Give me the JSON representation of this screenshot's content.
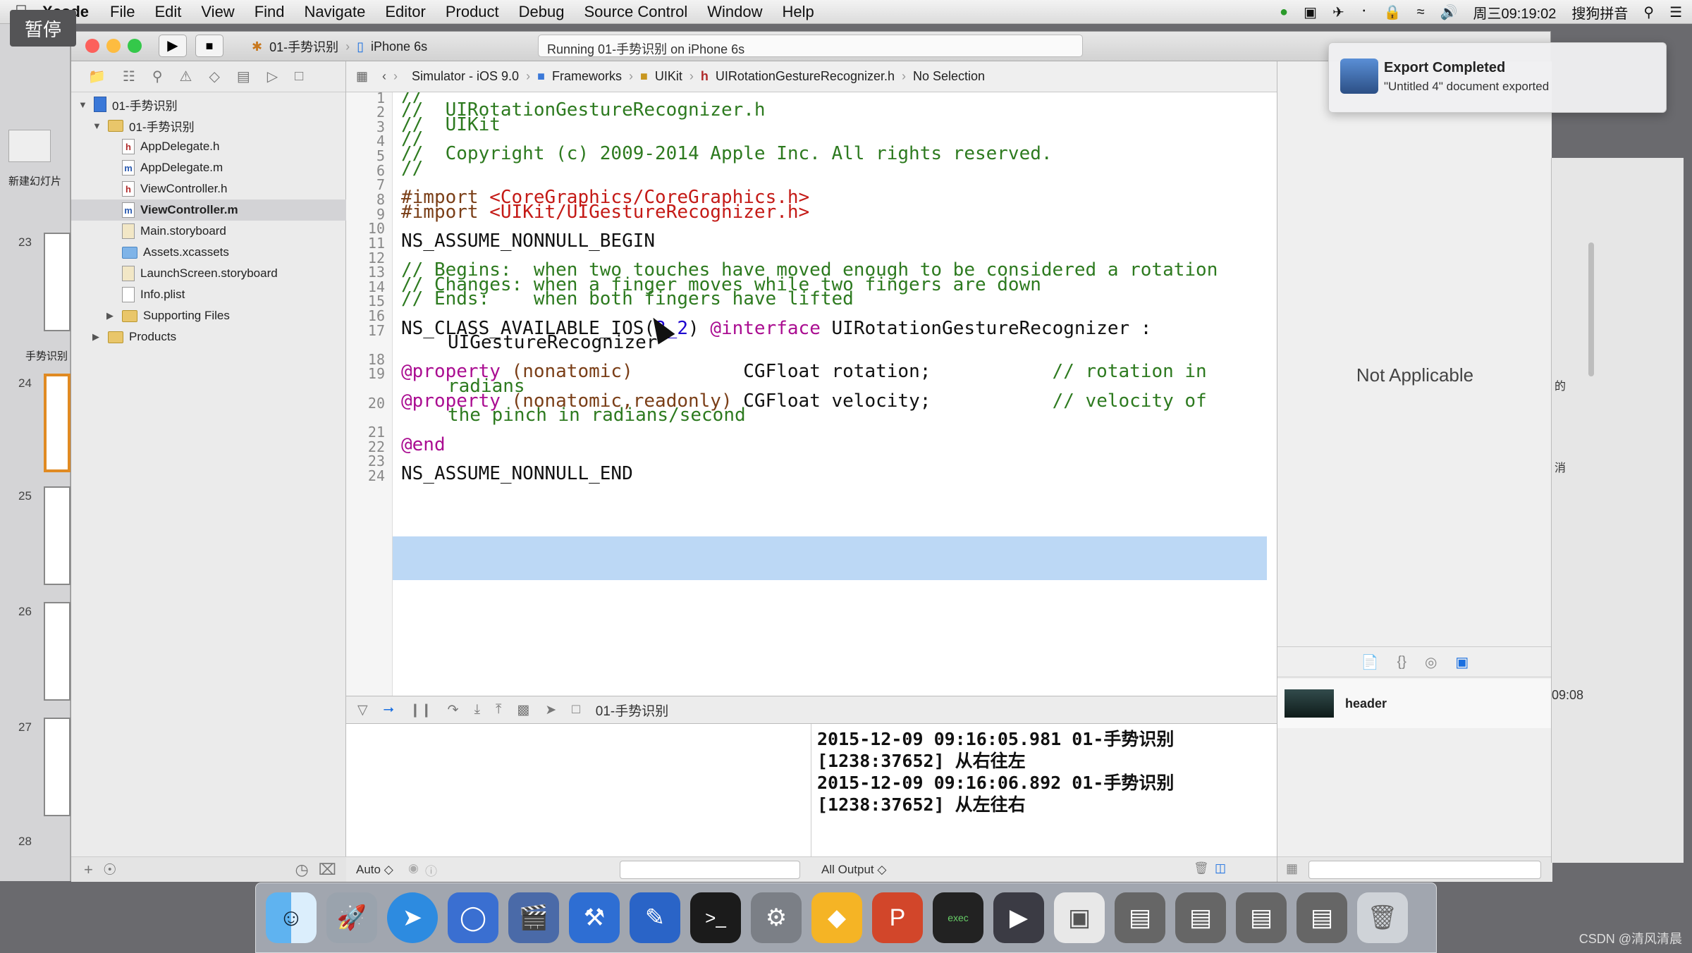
{
  "menubar": {
    "app_name": "Xcode",
    "items": [
      "File",
      "Edit",
      "View",
      "Find",
      "Navigate",
      "Editor",
      "Product",
      "Debug",
      "Source Control",
      "Window",
      "Help"
    ],
    "clock": "周三09:19:02",
    "input_method": "搜狗拼音"
  },
  "keynote": {
    "pause_label": "暂停",
    "new_slide_label": "新建幻灯片",
    "group_label": "手势识别",
    "slide_numbers": [
      "23",
      "24",
      "25",
      "26",
      "27",
      "28"
    ]
  },
  "toolbar": {
    "scheme": "01-手势识别",
    "device": "iPhone 6s",
    "activity": "Running 01-手势识别 on iPhone 6s"
  },
  "navigator": {
    "project": "01-手势识别",
    "group": "01-手势识别",
    "files": [
      {
        "name": "AppDelegate.h",
        "icon": "h"
      },
      {
        "name": "AppDelegate.m",
        "icon": "m"
      },
      {
        "name": "ViewController.h",
        "icon": "h"
      },
      {
        "name": "ViewController.m",
        "icon": "m"
      },
      {
        "name": "Main.storyboard",
        "icon": "storyboard"
      },
      {
        "name": "Assets.xcassets",
        "icon": "folder"
      },
      {
        "name": "LaunchScreen.storyboard",
        "icon": "storyboard"
      },
      {
        "name": "Info.plist",
        "icon": "plist"
      }
    ],
    "supporting": "Supporting Files",
    "products": "Products"
  },
  "jumpbar": {
    "items": [
      "Simulator - iOS 9.0",
      "Frameworks",
      "UIKit",
      "UIRotationGestureRecognizer.h",
      "No Selection"
    ]
  },
  "editor": {
    "line_numbers": [
      "1",
      "2",
      "3",
      "4",
      "5",
      "6",
      "7",
      "8",
      "9",
      "10",
      "11",
      "12",
      "13",
      "14",
      "15",
      "16",
      "17",
      "18",
      "19",
      "20",
      "21",
      "22",
      "23",
      "24"
    ],
    "lines": {
      "l1": "//",
      "l2": "//  UIRotationGestureRecognizer.h",
      "l3": "//  UIKit",
      "l4": "//",
      "l5": "//  Copyright (c) 2009-2014 Apple Inc. All rights reserved.",
      "l6": "//",
      "l8_kw": "#import ",
      "l8_str": "<CoreGraphics/CoreGraphics.h>",
      "l9_kw": "#import ",
      "l9_str": "<UIKit/UIGestureRecognizer.h>",
      "l11": "NS_ASSUME_NONNULL_BEGIN",
      "l13": "// Begins:  when two touches have moved enough to be considered a rotation",
      "l14": "// Changes: when a finger moves while two fingers are down",
      "l15": "// Ends:    when both fingers have lifted",
      "l17_a": "NS_CLASS_AVAILABLE_IOS(",
      "l17_num": "3_2",
      "l17_b": ") ",
      "l17_kw": "@interface",
      "l17_c": " UIRotationGestureRecognizer :",
      "l17_cont": "UIGestureRecognizer",
      "l19_kw": "@property",
      "l19_attr": " (nonatomic)",
      "l19_decl": "          CGFloat rotation;",
      "l19_comment": "           // rotation in",
      "l19_cont": "radians",
      "l20_kw": "@property",
      "l20_attr": " (nonatomic,readonly)",
      "l20_decl": " CGFloat velocity;",
      "l20_comment": "           // velocity of",
      "l20_cont": "the pinch in radians/second",
      "l22": "@end",
      "l24": "NS_ASSUME_NONNULL_END"
    }
  },
  "debug": {
    "target": "01-手势识别",
    "auto_label": "Auto ◇",
    "output_label": "All Output ◇",
    "console": [
      "2015-12-09 09:16:05.981 01-手势识别",
      "[1238:37652] 从右往左",
      "2015-12-09 09:16:06.892 01-手势识别",
      "[1238:37652] 从左往右"
    ]
  },
  "inspector": {
    "not_applicable": "Not Applicable",
    "library_item": "header"
  },
  "notification": {
    "title": "Export Completed",
    "body": "\"Untitled 4\" document exported"
  },
  "background_app": {
    "labels": [
      "的",
      "消",
      "09:08"
    ]
  },
  "watermark": "CSDN @清风清晨",
  "colors": {
    "selection": "#bcd8f5",
    "comment": "#2d7a1f",
    "string": "#c41a16",
    "keyword": "#aa0d91",
    "number": "#1c00cf",
    "accent": "#1a6fe0"
  }
}
